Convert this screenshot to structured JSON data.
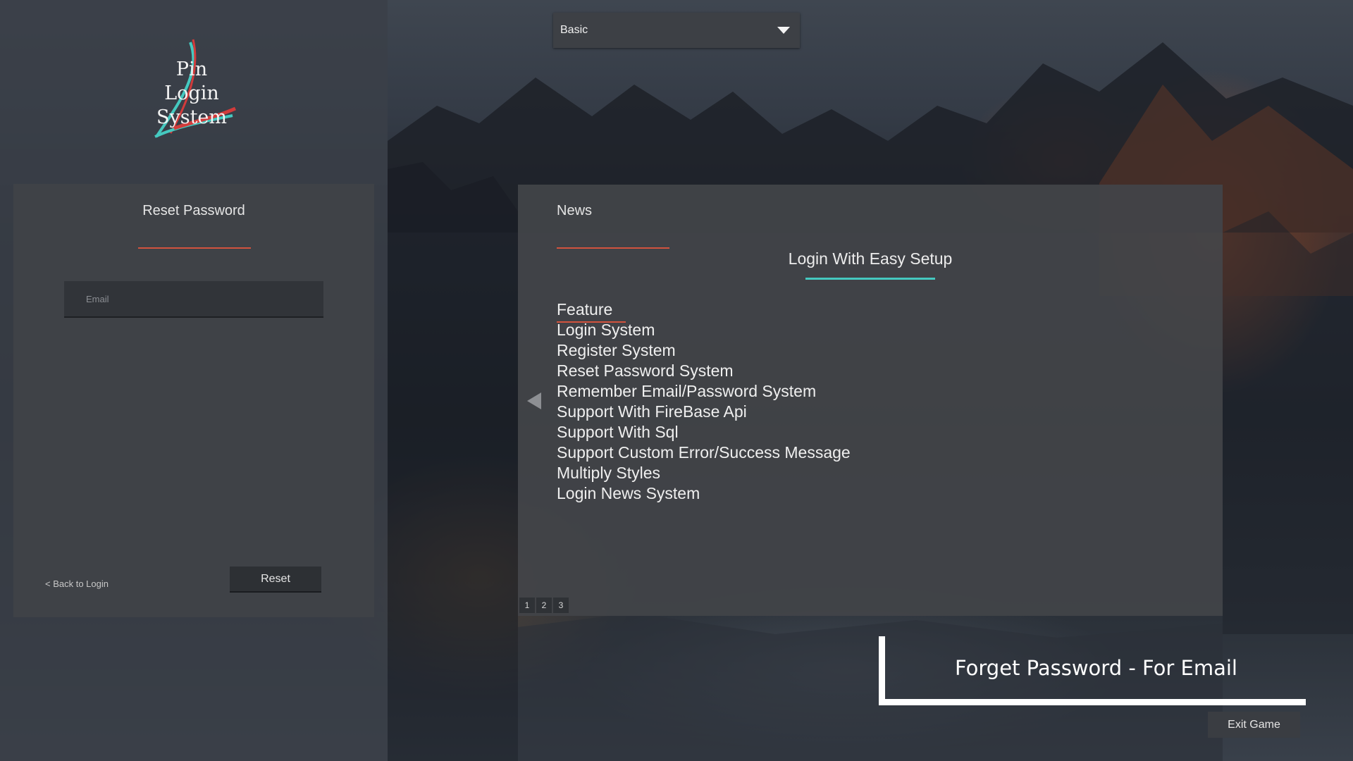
{
  "logo": {
    "lines": [
      "Pin",
      "Login",
      "System"
    ],
    "icon": "pin-logo-icon"
  },
  "reset_card": {
    "title": "Reset Password",
    "email_placeholder": "Email",
    "email_value": "",
    "back_link": "< Back to Login",
    "reset_button": "Reset"
  },
  "style_dropdown": {
    "selected": "Basic",
    "icon": "chevron-down-icon"
  },
  "news": {
    "title": "News",
    "headline": "Login With Easy Setup",
    "feature_heading": "Feature",
    "features": [
      "Login System",
      "Register System",
      "Reset Password System",
      "Remember Email/Password System",
      "Support With FireBase Api",
      "Support With Sql",
      "Support Custom Error/Success Message",
      "Multiply Styles",
      "Login News System"
    ],
    "pages": [
      "1",
      "2",
      "3"
    ],
    "prev_icon": "arrow-left-icon"
  },
  "caption": "Forget Password - For Email",
  "exit_button": "Exit Game",
  "colors": {
    "accent_red": "#d2533e",
    "accent_teal": "#45c9c0",
    "card_bg": "#3f4247",
    "panel_bg": "#424448"
  }
}
